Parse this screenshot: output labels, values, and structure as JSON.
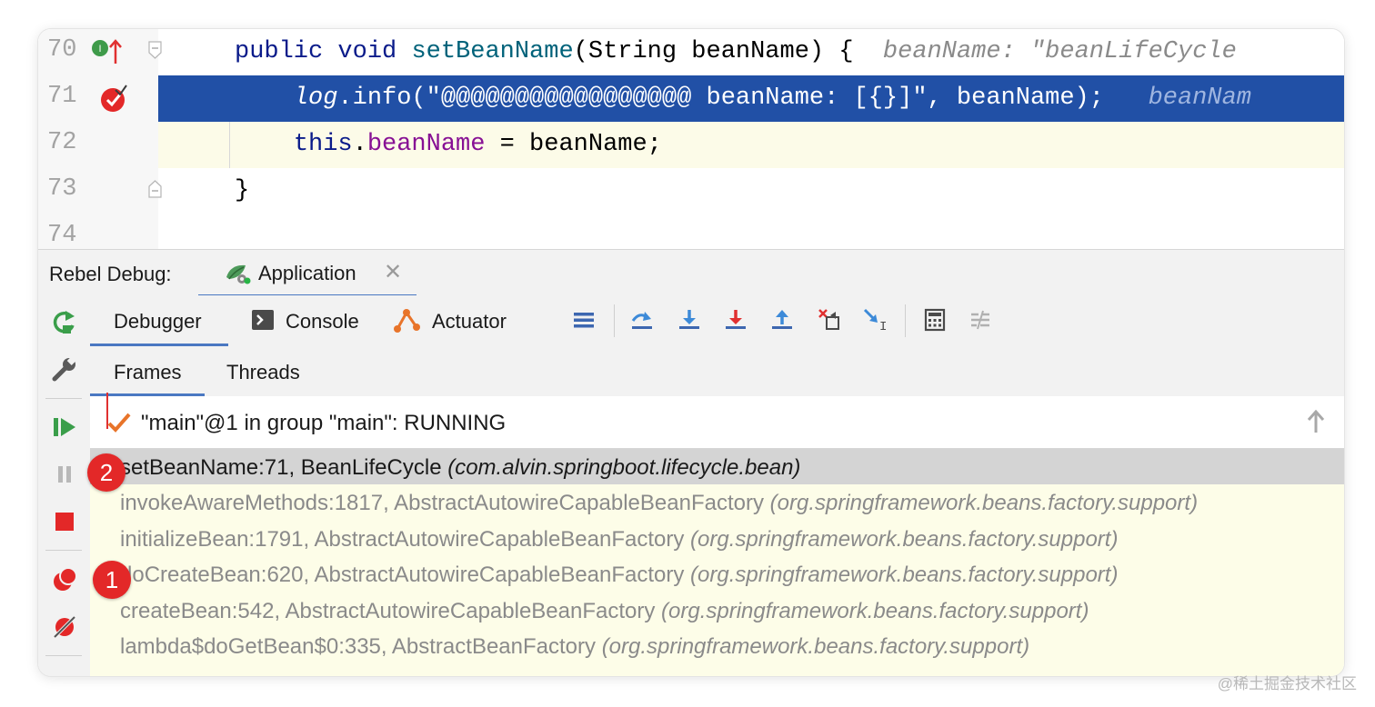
{
  "editor": {
    "lines": [
      {
        "num": "70",
        "tokens": [
          {
            "t": "public ",
            "c": "kw"
          },
          {
            "t": "void ",
            "c": "kw"
          },
          {
            "t": "setBeanName",
            "c": "fn"
          },
          {
            "t": "(String beanName) {",
            "c": ""
          },
          {
            "t": "  beanName: \"beanLifeCycle",
            "c": "hint"
          }
        ]
      },
      {
        "num": "71",
        "tokens": [
          {
            "t": "    ",
            "c": ""
          },
          {
            "t": "log",
            "c": "it"
          },
          {
            "t": ".info(\"@@@@@@@@@@@@@@@@@ beanName: [{}]\", beanName);",
            "c": ""
          },
          {
            "t": "   beanNam",
            "c": "hint"
          }
        ]
      },
      {
        "num": "72",
        "tokens": [
          {
            "t": "    ",
            "c": ""
          },
          {
            "t": "this",
            "c": "kw"
          },
          {
            "t": ".",
            "c": ""
          },
          {
            "t": "beanName",
            "c": "fld"
          },
          {
            "t": " = beanName;",
            "c": ""
          }
        ]
      },
      {
        "num": "73",
        "tokens": [
          {
            "t": "}",
            "c": ""
          }
        ]
      },
      {
        "num": "74",
        "tokens": []
      }
    ]
  },
  "debug_bar": {
    "title": "Rebel Debug:",
    "tab_label": "Application",
    "close": "✕"
  },
  "toolbar": {
    "debugger": "Debugger",
    "console": "Console",
    "actuator": "Actuator"
  },
  "frames_tabs": {
    "frames": "Frames",
    "threads": "Threads"
  },
  "thread": {
    "label": "\"main\"@1 in group \"main\": RUNNING"
  },
  "frames": [
    {
      "method": "setBeanName:71, BeanLifeCycle ",
      "pkg": "(com.alvin.springboot.lifecycle.bean)"
    },
    {
      "method": "invokeAwareMethods:1817, AbstractAutowireCapableBeanFactory ",
      "pkg": "(org.springframework.beans.factory.support)"
    },
    {
      "method": "initializeBean:1791, AbstractAutowireCapableBeanFactory ",
      "pkg": "(org.springframework.beans.factory.support)"
    },
    {
      "method": "doCreateBean:620, AbstractAutowireCapableBeanFactory ",
      "pkg": "(org.springframework.beans.factory.support)"
    },
    {
      "method": "createBean:542, AbstractAutowireCapableBeanFactory ",
      "pkg": "(org.springframework.beans.factory.support)"
    },
    {
      "method": "lambda$doGetBean$0:335, AbstractBeanFactory ",
      "pkg": "(org.springframework.beans.factory.support)"
    }
  ],
  "annotations": {
    "badge_1": "1",
    "badge_2": "2"
  },
  "watermark": "@稀土掘金技术社区",
  "colors": {
    "selection": "#2150a6",
    "accent_tab": "#4a78c2",
    "badge": "#e32828",
    "frames_bg": "#fdfde8"
  }
}
